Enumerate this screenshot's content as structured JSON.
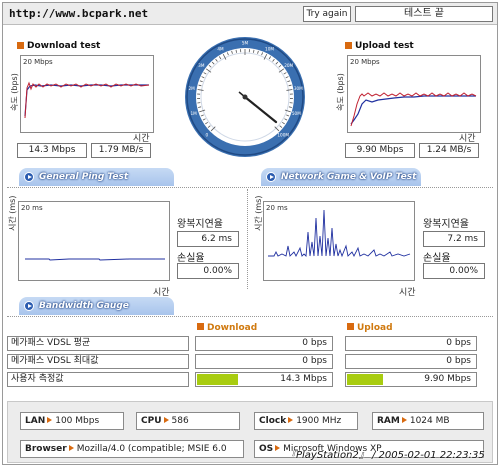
{
  "header": {
    "url": "http://www.bcpark.net",
    "try_again_label": "Try again",
    "status_text": "테스트 끝"
  },
  "download": {
    "title": "Download test",
    "y_axis_label": "속도 (bps)",
    "max_label": "20 Mbps",
    "x_axis_label": "시간",
    "speed_mbps": "14.3 Mbps",
    "speed_mbs": "1.79 MB/s"
  },
  "upload": {
    "title": "Upload test",
    "y_axis_label": "속도 (bps)",
    "max_label": "20 Mbps",
    "x_axis_label": "시간",
    "speed_mbps": "9.90 Mbps",
    "speed_mbs": "1.24 MB/s"
  },
  "gauge": {
    "ticks": [
      "0",
      "1M",
      "2M",
      "3M",
      "4M",
      "5M",
      "10M",
      "20M",
      "30M",
      "50M",
      "100M"
    ]
  },
  "ping": {
    "tab_label": "General Ping Test",
    "y_axis_label": "시간 (ms)",
    "max_label": "20 ms",
    "x_axis_label": "시간",
    "rtt_label": "왕복지연율",
    "rtt_value": "6.2 ms",
    "loss_label": "손실율",
    "loss_value": "0.00%"
  },
  "game": {
    "tab_label": "Network Game & VoIP Test",
    "y_axis_label": "시간 (ms)",
    "max_label": "20 ms",
    "x_axis_label": "시간",
    "rtt_label": "왕복지연율",
    "rtt_value": "7.2 ms",
    "loss_label": "손실율",
    "loss_value": "0.00%"
  },
  "bandwidth": {
    "tab_label": "Bandwidth Gauge",
    "download_header": "Download",
    "upload_header": "Upload",
    "rows": [
      {
        "label": "메가패스 VDSL 평균",
        "download": "0 bps",
        "download_fill": 0,
        "upload": "0 bps",
        "upload_fill": 0
      },
      {
        "label": "메가패스 VDSL 최대값",
        "download": "0 bps",
        "download_fill": 0,
        "upload": "0 bps",
        "upload_fill": 0
      },
      {
        "label": "사용자 측정값",
        "download": "14.3 Mbps",
        "download_fill": 0.3,
        "upload": "9.90 Mbps",
        "upload_fill": 0.28
      }
    ]
  },
  "info": {
    "lan_label": "LAN",
    "lan_value": "100 Mbps",
    "cpu_label": "CPU",
    "cpu_value": "586",
    "clock_label": "Clock",
    "clock_value": "1900 MHz",
    "ram_label": "RAM",
    "ram_value": "1024 MB",
    "browser_label": "Browser",
    "browser_value": "Mozilla/4.0 (compatible; MSIE 6.0",
    "os_label": "OS",
    "os_value": "Microsoft Windows XP"
  },
  "watermark": "『PlayStation2』 / 2005-02-01 22:23:35",
  "colors": {
    "accent_orange": "#d86a10",
    "bar_green": "#a8cc10",
    "gauge_blue": "#3a6fb0"
  }
}
